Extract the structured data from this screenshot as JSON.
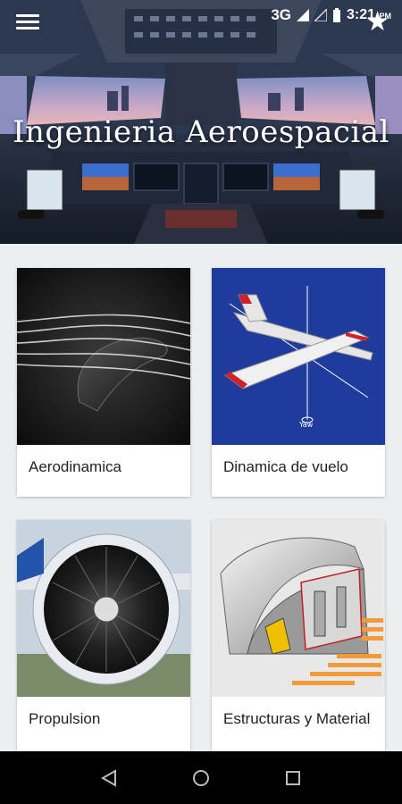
{
  "status_bar": {
    "network": "3G",
    "time": "3:21",
    "time_suffix": "PM"
  },
  "header": {
    "title": "Ingenieria Aeroespacial",
    "menu_icon": "hamburger-menu-icon",
    "favorite_icon": "star-icon"
  },
  "cards": [
    {
      "label": "Aerodinamica",
      "image": "airflow-wing-image"
    },
    {
      "label": "Dinamica de vuelo",
      "image": "airplane-axes-image"
    },
    {
      "label": "Propulsion",
      "image": "jet-engine-image"
    },
    {
      "label": "Estructuras y Material",
      "image": "wing-structure-image"
    }
  ],
  "nav": {
    "back": "back-icon",
    "home": "home-icon",
    "recents": "recents-icon"
  },
  "colors": {
    "card_bg": "#ffffff",
    "page_bg": "#eceff1",
    "navbar": "#000000",
    "blueprint_bg": "#1f3c9c"
  }
}
